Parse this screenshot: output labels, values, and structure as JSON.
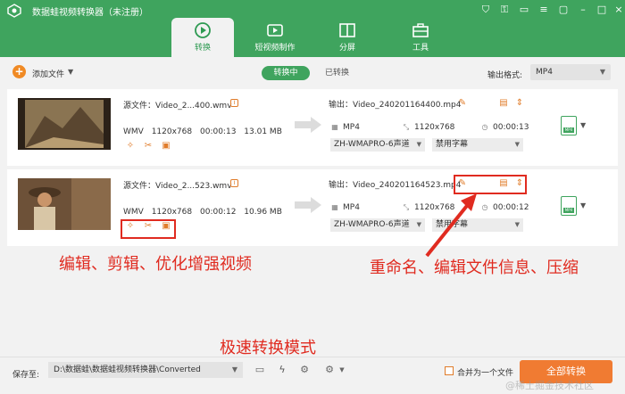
{
  "app": {
    "title": "数据蛙视频转换器（未注册）",
    "accent": "#3fa45e",
    "orange": "#f07b32"
  },
  "tabs": [
    {
      "label": "转换",
      "icon": "convert-icon",
      "active": true
    },
    {
      "label": "短视频制作",
      "icon": "short-video-icon",
      "active": false
    },
    {
      "label": "分屏",
      "icon": "split-screen-icon",
      "active": false
    },
    {
      "label": "工具",
      "icon": "toolbox-icon",
      "active": false
    }
  ],
  "toolbar": {
    "add_file": "添加文件",
    "seg_converting": "转换中",
    "seg_converted": "已转换",
    "output_format_label": "输出格式:",
    "output_format_value": "MP4"
  },
  "files": [
    {
      "source": "源文件：Video_2...400.wmv",
      "format": "WMV",
      "resolution": "1120x768",
      "duration": "00:00:13",
      "size": "13.01 MB",
      "output_name": "输出：Video_240201164400.mp4",
      "out_format": "MP4",
      "out_resolution": "1120x768",
      "out_duration": "00:00:13",
      "audio": "ZH-WMAPRO-6声道",
      "subtitle": "禁用字幕"
    },
    {
      "source": "源文件：Video_2...523.wmv",
      "format": "WMV",
      "resolution": "1120x768",
      "duration": "00:00:12",
      "size": "10.96 MB",
      "output_name": "输出：Video_240201164523.mp4",
      "out_format": "MP4",
      "out_resolution": "1120x768",
      "out_duration": "00:00:12",
      "audio": "ZH-WMAPRO-6声道",
      "subtitle": "禁用字幕"
    }
  ],
  "annotations": {
    "left": "编辑、剪辑、优化增强视频",
    "right": "重命名、编辑文件信息、压缩",
    "bottom": "极速转换模式"
  },
  "footer": {
    "save_label": "保存至:",
    "save_path": "D:\\数据蛙\\数据蛙视频转换器\\Converted",
    "merge_label": "合并为一个文件",
    "convert_all": "全部转换"
  },
  "watermark": "@稀土掘金技术社区"
}
